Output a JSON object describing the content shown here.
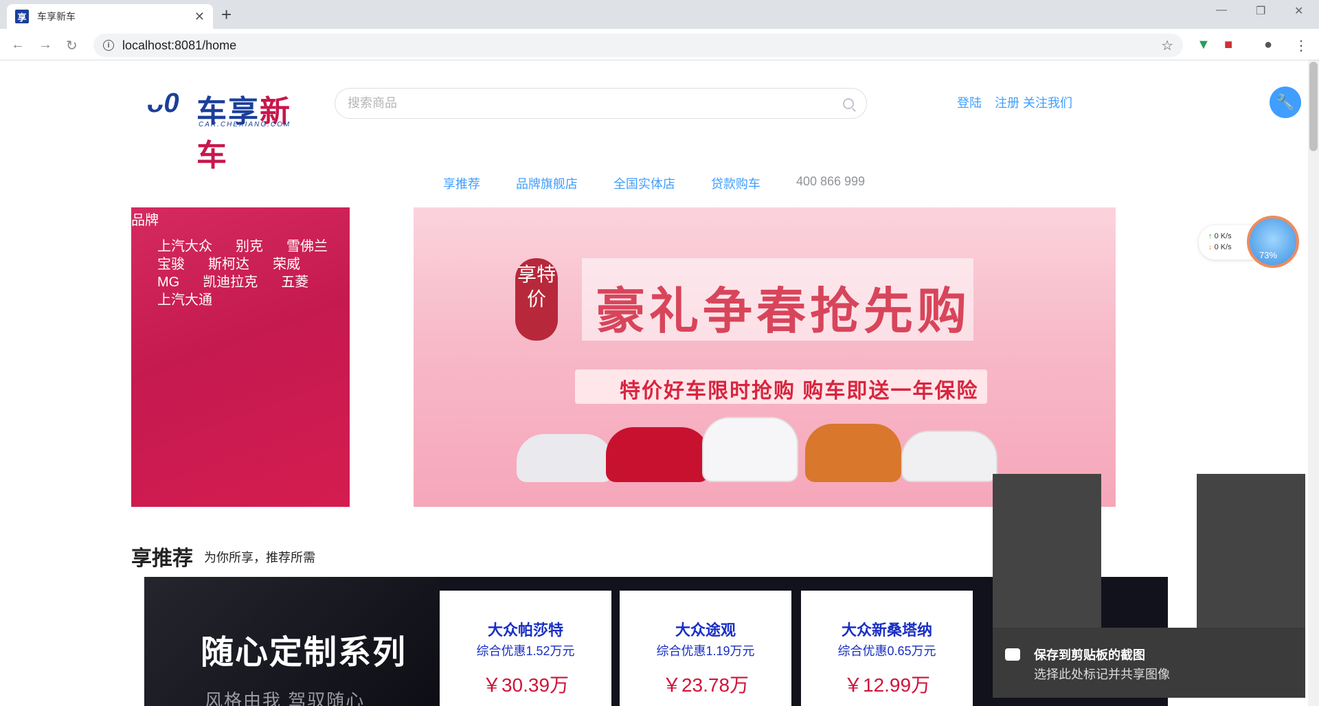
{
  "browser": {
    "tab_title": "车享新车",
    "favicon_char": "享",
    "new_tab": "+",
    "close": "✕",
    "url": "localhost:8081/home"
  },
  "header": {
    "logo_mark": "ᴗ0",
    "logo_blue": "车享",
    "logo_red": "新车",
    "logo_sub": "CAR.CHEXIANG.COM",
    "search_placeholder": "搜索商品",
    "login": "登陆",
    "register_follow": "注册 关注我们"
  },
  "nav": {
    "items": [
      "享推荐",
      "品牌旗舰店",
      "全国实体店",
      "贷款购车"
    ],
    "phone": "400 866 999"
  },
  "brands": {
    "title": "品牌",
    "list": [
      "上汽大众",
      "别克",
      "雪佛兰",
      "宝骏",
      "斯柯达",
      "荣威",
      "MG",
      "凯迪拉克",
      "五菱",
      "上汽大通"
    ]
  },
  "banner": {
    "seal": "享特价",
    "headline": "豪礼争春抢先购",
    "ribbon": "特价好车限时抢购  购车即送一年保险"
  },
  "recommend": {
    "title": "享推荐",
    "subtitle": "为你所享，推荐所需",
    "promo_title": "随心定制系列",
    "promo_sub": "风格由我 驾驭随心",
    "cards": [
      {
        "name": "大众帕莎特",
        "discount": "综合优惠1.52万元",
        "price": "￥30.39万"
      },
      {
        "name": "大众途观",
        "discount": "综合优惠1.19万元",
        "price": "￥23.78万"
      },
      {
        "name": "大众新桑塔纳",
        "discount": "综合优惠0.65万元",
        "price": "￥12.99万"
      }
    ]
  },
  "widgets": {
    "net_up": "0  K/s",
    "net_down": "0  K/s",
    "assistant_pct": "73%"
  },
  "clipboard_toast": {
    "title": "保存到剪贴板的截图",
    "subtitle": "选择此处标记并共享图像"
  },
  "colors": {
    "accent": "#409eff",
    "brand_red": "#c8174b",
    "brand_blue": "#1b3f9a",
    "price_red": "#d0133a"
  }
}
